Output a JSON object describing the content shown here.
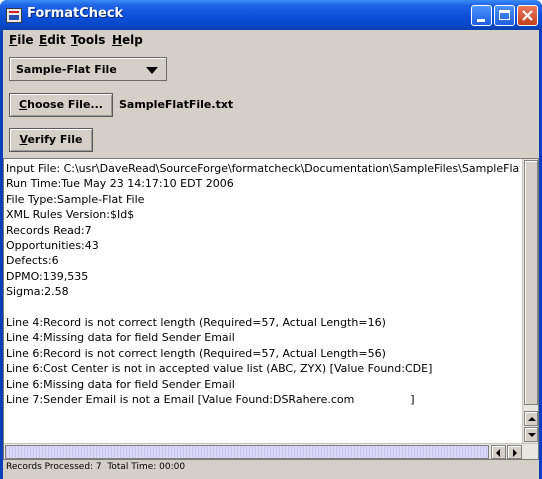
{
  "window": {
    "title": "FormatCheck"
  },
  "menu": {
    "file": {
      "mnemonic": "F",
      "rest": "ile"
    },
    "edit": {
      "mnemonic": "E",
      "rest": "dit"
    },
    "tools": {
      "mnemonic": "T",
      "rest": "ools"
    },
    "help": {
      "mnemonic": "H",
      "rest": "elp"
    }
  },
  "file_type_select": {
    "selected": "Sample-Flat File"
  },
  "choose_button": {
    "mnemonic": "C",
    "rest": "hoose File..."
  },
  "selected_file": "SampleFlatFile.txt",
  "verify_button": {
    "mnemonic": "V",
    "rest": "erify File"
  },
  "output": {
    "text": "Input File: C:\\usr\\DaveRead\\SourceForge\\formatcheck\\Documentation\\SampleFiles\\SampleFlatFile.txt\nRun Time:Tue May 23 14:17:10 EDT 2006\nFile Type:Sample-Flat File\nXML Rules Version:$Id$\nRecords Read:7\nOpportunities:43\nDefects:6\nDPMO:139,535\nSigma:2.58\n\nLine 4:Record is not correct length (Required=57, Actual Length=16)\nLine 4:Missing data for field Sender Email\nLine 6:Record is not correct length (Required=57, Actual Length=56)\nLine 6:Cost Center is not in accepted value list (ABC, ZYX) [Value Found:CDE]\nLine 6:Missing data for field Sender Email\nLine 7:Sender Email is not a Email [Value Found:DSRahere.com                ]"
  },
  "status": {
    "text": "Records Processed: 7  Total Time: 00:00"
  },
  "colors": {
    "titlebar": "#0b4fd8",
    "window_face": "#d4d0c8",
    "close_button": "#c2401c"
  }
}
